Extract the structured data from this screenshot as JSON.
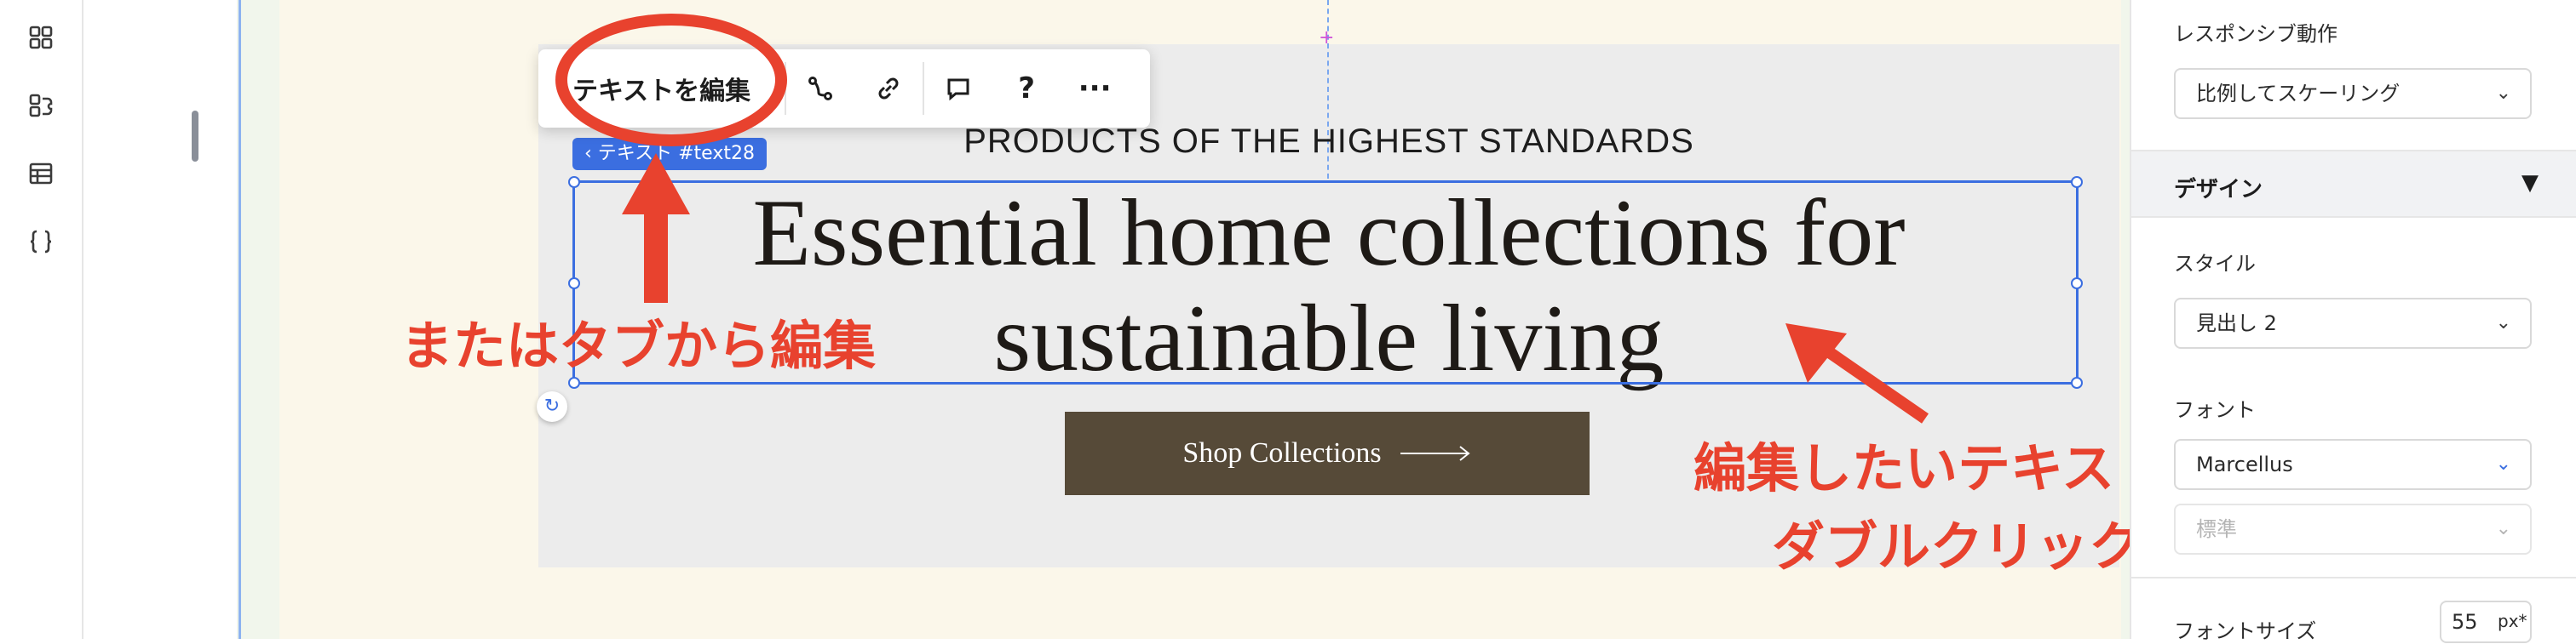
{
  "rail": {
    "icons": [
      "apps-icon",
      "add-section-icon",
      "table-icon",
      "code-braces-icon"
    ]
  },
  "canvas": {
    "toolbar": {
      "edit_text_label": "テキストを編集",
      "more_label": "···",
      "help_label": "?"
    },
    "selection_tag": "‹ テキスト #text28",
    "subtitle": "PRODUCTS OF THE HIGHEST STANDARDS",
    "heading_line1": "Essential home collections for",
    "heading_line2": "sustainable living",
    "cta_label": "Shop Collections"
  },
  "annotations": {
    "left": "またはタブから編集",
    "right_line1": "編集したいテキストを",
    "right_line2": "ダブルクリック",
    "color": "#e8422e"
  },
  "panel": {
    "responsive_label": "レスポンシブ動作",
    "responsive_value": "比例してスケーリング",
    "design_label": "デザイン",
    "style_label": "スタイル",
    "style_value": "見出し 2",
    "font_label": "フォント",
    "font_value": "Marcellus",
    "weight_value": "標準",
    "font_size_label": "フォントサイズ",
    "font_size_value": "55",
    "font_size_unit": "px*"
  },
  "colors": {
    "accent": "#3b6ee0",
    "cta_bg": "#564a38",
    "hero_bg": "#ececec"
  }
}
